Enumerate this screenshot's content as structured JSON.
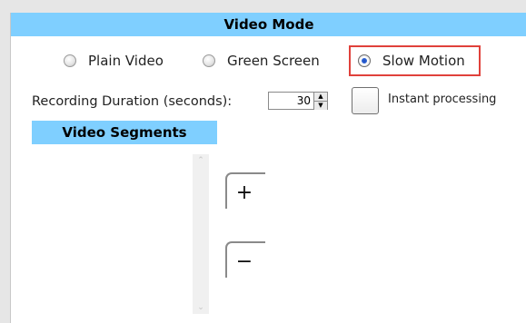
{
  "video_mode": {
    "title": "Video Mode",
    "options": [
      {
        "label": "Plain Video",
        "selected": false
      },
      {
        "label": "Green Screen",
        "selected": false
      },
      {
        "label": "Slow Motion",
        "selected": true
      }
    ],
    "highlight_color": "#e0413b"
  },
  "recording": {
    "duration_label": "Recording Duration (seconds):",
    "duration_value": "30",
    "instant_label": "Instant processing",
    "instant_checked": false
  },
  "segments": {
    "title": "Video Segments",
    "add_symbol": "+",
    "remove_symbol": "−",
    "scroll_up_symbol": "⌃",
    "scroll_down_symbol": "⌄"
  },
  "colors": {
    "header_bg": "#7fcfff",
    "radio_selected": "#2e63d6"
  }
}
